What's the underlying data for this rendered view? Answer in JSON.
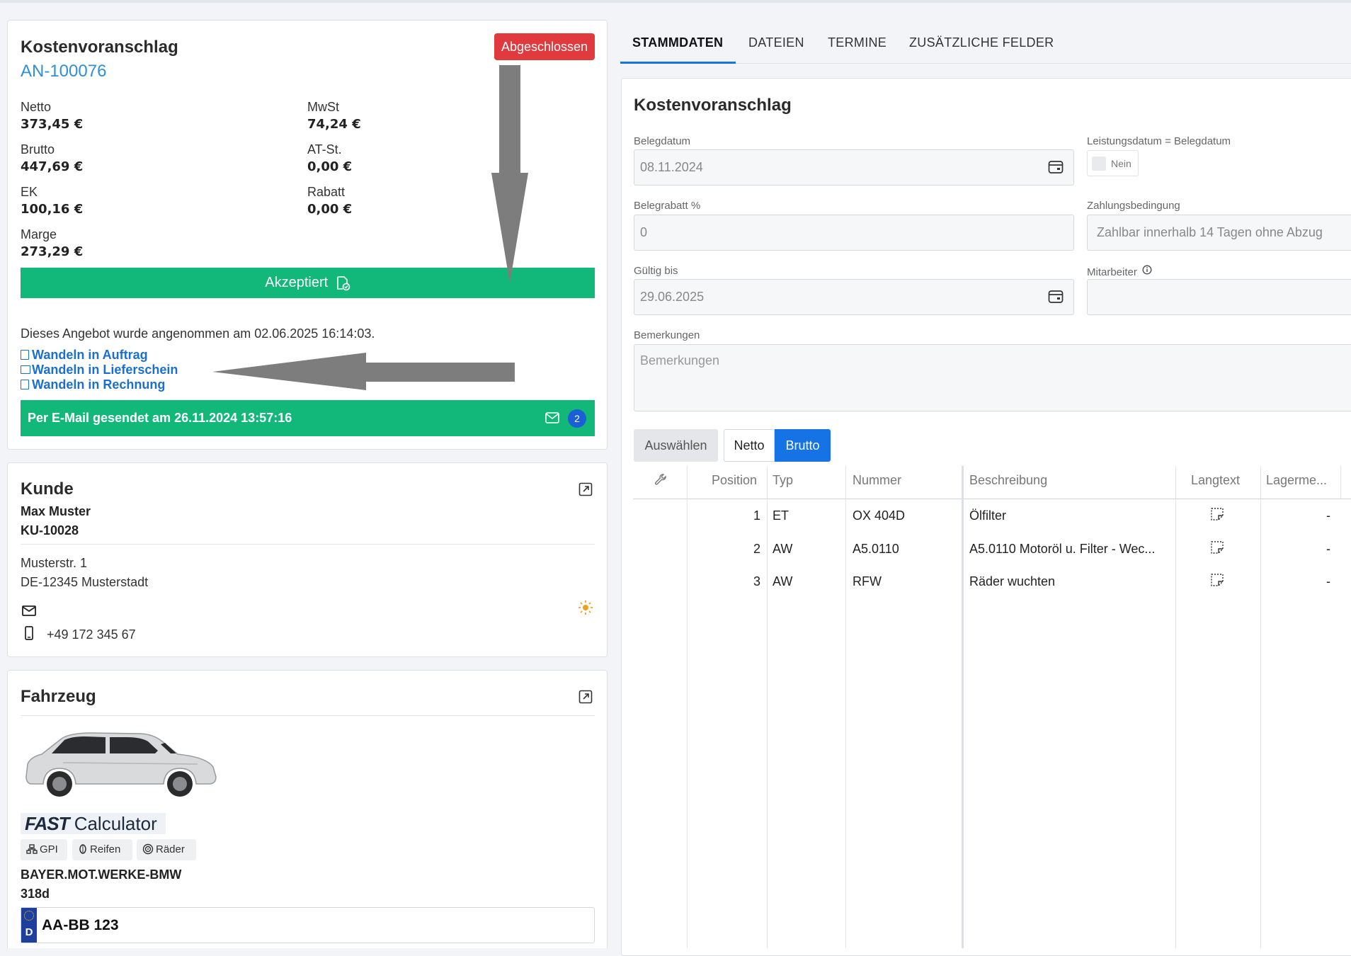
{
  "summary": {
    "title": "Kostenvoranschlag",
    "number": "AN-100076",
    "status": "Abgeschlossen",
    "amounts": [
      {
        "label": "Netto",
        "value": "373,45 €"
      },
      {
        "label": "MwSt",
        "value": "74,24 €"
      },
      {
        "label": "Brutto",
        "value": "447,69 €"
      },
      {
        "label": "AT-St.",
        "value": "0,00 €"
      },
      {
        "label": "EK",
        "value": "100,16 €"
      },
      {
        "label": "Rabatt",
        "value": "0,00 €"
      },
      {
        "label": "Marge",
        "value": "273,29 €"
      }
    ],
    "accepted_label": "Akzeptiert",
    "accepted_text": "Dieses Angebot wurde angenommen am 02.06.2025 16:14:03.",
    "links": [
      "Wandeln in Auftrag",
      "Wandeln in Lieferschein",
      "Wandeln in Rechnung"
    ],
    "email_text": "Per E-Mail gesendet am 26.11.2024 13:57:16",
    "email_count": "2",
    "accent_green": "#12b87a",
    "status_red": "#e0393e"
  },
  "customer": {
    "title": "Kunde",
    "name": "Max Muster",
    "number": "KU-10028",
    "street": "Musterstr. 1",
    "city": "DE-12345 Musterstadt",
    "phone": "+49 172 345 67"
  },
  "vehicle": {
    "title": "Fahrzeug",
    "logo_fast": "FAST",
    "logo_calc": "Calculator",
    "chips": [
      "GPI",
      "Reifen",
      "Räder"
    ],
    "make": "BAYER.MOT.WERKE-BMW",
    "model": "318d",
    "plate_country": "D",
    "plate": "AA-BB 123"
  },
  "tabs": [
    "STAMMDATEN",
    "DATEIEN",
    "TERMINE",
    "ZUSÄTZLICHE FELDER"
  ],
  "form": {
    "title": "Kostenvoranschlag",
    "belegdatum_label": "Belegdatum",
    "belegdatum": "08.11.2024",
    "leistungsdatum_label": "Leistungsdatum = Belegdatum",
    "leistungsdatum_toggle": "Nein",
    "belegrabatt_label": "Belegrabatt %",
    "belegrabatt": "0",
    "zahlung_label": "Zahlungsbedingung",
    "zahlung": "Zahlbar innerhalb 14 Tagen ohne Abzug",
    "gueltig_label": "Gültig bis",
    "gueltig": "29.06.2025",
    "mitarbeiter_label": "Mitarbeiter",
    "bemerkungen_label": "Bemerkungen",
    "bemerkungen_placeholder": "Bemerkungen",
    "auswaehlen": "Auswählen",
    "netto": "Netto",
    "brutto": "Brutto",
    "brutto_active_color": "#1573e5"
  },
  "table": {
    "headers": [
      "Position",
      "Typ",
      "Nummer",
      "Beschreibung",
      "Langtext",
      "Lagerme..."
    ],
    "rows": [
      {
        "pos": "1",
        "typ": "ET",
        "nummer": "OX 404D",
        "beschreibung": "Ölfilter",
        "lager": "-"
      },
      {
        "pos": "2",
        "typ": "AW",
        "nummer": "A5.0110",
        "beschreibung": "A5.0110 Motoröl u. Filter - Wec...",
        "lager": "-"
      },
      {
        "pos": "3",
        "typ": "AW",
        "nummer": "RFW",
        "beschreibung": "Räder wuchten",
        "lager": "-"
      }
    ]
  }
}
